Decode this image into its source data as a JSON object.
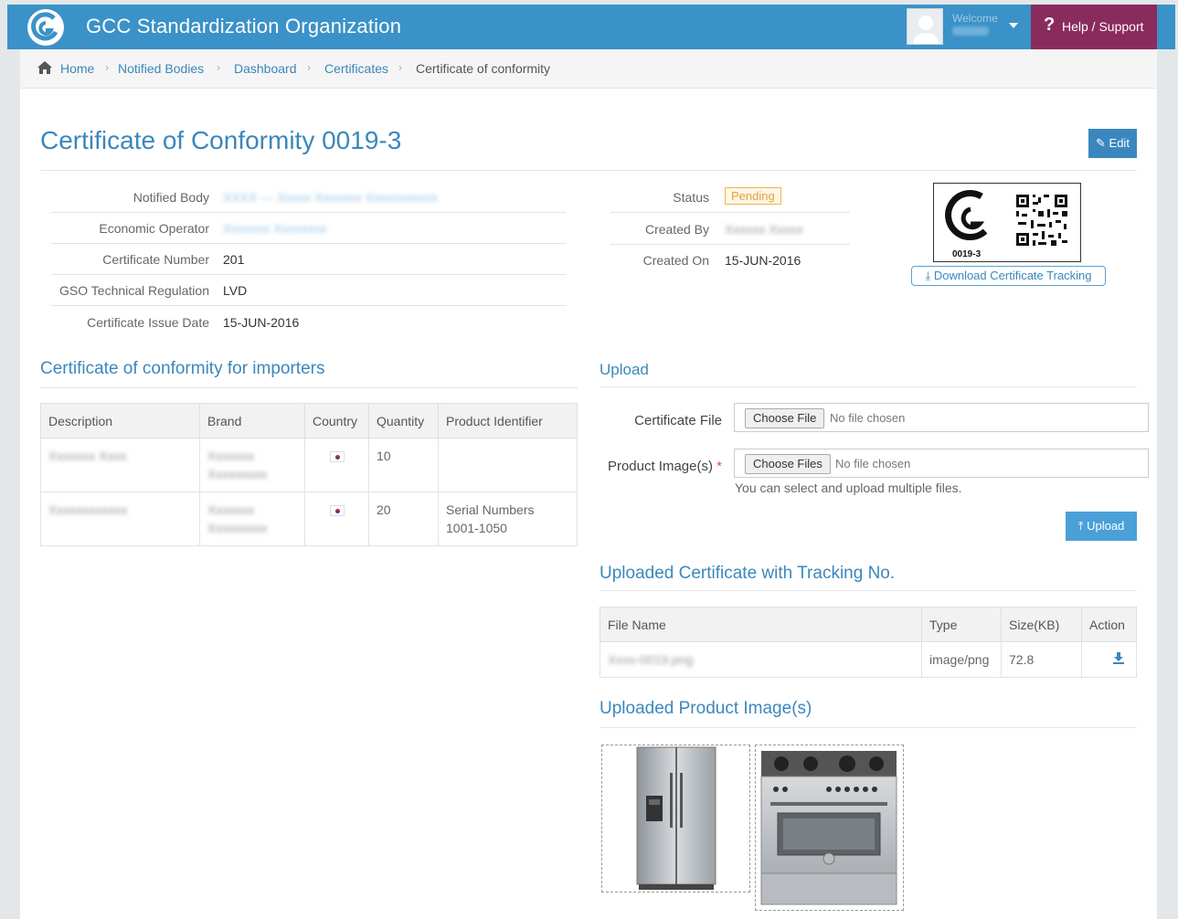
{
  "header": {
    "app_title": "GCC Standardization Organization",
    "welcome": "Welcome",
    "help_label": "Help / Support",
    "logo_icon": "gso-logo-icon",
    "colors": {
      "bar": "#3a92c8",
      "help": "#8a2b5e",
      "accent": "#3b87bd"
    }
  },
  "breadcrumb": [
    "Home",
    "Notified Bodies",
    "Dashboard",
    "Certificates",
    "Certificate of conformity"
  ],
  "page": {
    "title": "Certificate of Conformity 0019-3",
    "edit_label": "Edit"
  },
  "info_left": [
    {
      "label": "Notified Body",
      "value": "",
      "blurred": true
    },
    {
      "label": "Economic Operator",
      "value": "",
      "blurred": true
    },
    {
      "label": "Certificate Number",
      "value": "201"
    },
    {
      "label": "GSO Technical Regulation",
      "value": "LVD"
    },
    {
      "label": "Certificate Issue Date",
      "value": "15-JUN-2016"
    }
  ],
  "info_right": {
    "status_label": "Status",
    "status_value": "Pending",
    "created_by_label": "Created By",
    "created_on_label": "Created On",
    "created_on_value": "15-JUN-2016"
  },
  "qr": {
    "code": "0019-3",
    "download_label": "Download Certificate Tracking"
  },
  "importers": {
    "title": "Certificate of conformity for importers",
    "columns": [
      "Description",
      "Brand",
      "Country",
      "Quantity",
      "Product Identifier"
    ],
    "rows": [
      {
        "quantity": "10",
        "identifier_line1": "",
        "identifier_line2": ""
      },
      {
        "quantity": "20",
        "identifier_line1": "Serial Numbers",
        "identifier_line2": "1001-1050"
      }
    ]
  },
  "upload": {
    "title": "Upload",
    "certificate_label": "Certificate File",
    "images_label": "Product Image(s)",
    "choose_file": "Choose File",
    "choose_files": "Choose Files",
    "no_file": "No file chosen",
    "hint": "You can select and upload multiple files.",
    "upload_button": "Upload"
  },
  "uploaded_cert": {
    "title": "Uploaded Certificate with Tracking No.",
    "columns": [
      "File Name",
      "Type",
      "Size(KB)",
      "Action"
    ],
    "rows": [
      {
        "type": "image/png",
        "size": "72.8",
        "action_icon": "download-icon"
      }
    ]
  },
  "uploaded_images": {
    "title": "Uploaded Product Image(s)",
    "images": [
      "refrigerator-image",
      "cooking-range-image"
    ]
  }
}
